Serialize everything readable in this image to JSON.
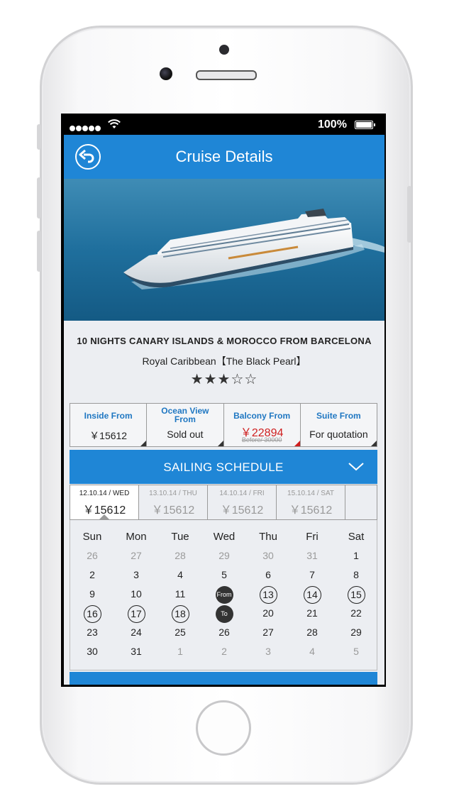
{
  "status_bar": {
    "battery": "100%"
  },
  "header": {
    "title": "Cruise Details"
  },
  "cruise": {
    "title": "10 NIGHTS CANARY ISLANDS & MOROCCO FROM BARCELONA",
    "line": "Royal Caribbean【The Black Pearl】",
    "stars": "★★★☆☆",
    "rating": 3
  },
  "cabins": [
    {
      "label": "Inside From",
      "value": "￥15612"
    },
    {
      "label": "Ocean View From",
      "value": "Sold out"
    },
    {
      "label": "Balcony From",
      "value": "￥22894",
      "before": "Before/ 30000"
    },
    {
      "label": "Suite From",
      "value": "For quotation"
    }
  ],
  "schedule": {
    "title": "SAILING SCHEDULE",
    "dates": [
      {
        "date": "12.10.14 / WED",
        "price": "￥15612"
      },
      {
        "date": "13.10.14 / THU",
        "price": "￥15612"
      },
      {
        "date": "14.10.14 / FRI",
        "price": "￥15612"
      },
      {
        "date": "15.10.14 / SAT",
        "price": "￥15612"
      }
    ]
  },
  "calendar": {
    "weekdays": [
      "Sun",
      "Mon",
      "Tue",
      "Wed",
      "Thu",
      "Fri",
      "Sat"
    ],
    "from_label": "From",
    "to_label": "To",
    "days": [
      "26",
      "27",
      "28",
      "29",
      "30",
      "31",
      "1",
      "2",
      "3",
      "4",
      "5",
      "6",
      "7",
      "8",
      "9",
      "10",
      "11",
      "From",
      "13",
      "14",
      "15",
      "16",
      "17",
      "18",
      "To",
      "20",
      "21",
      "22",
      "23",
      "24",
      "25",
      "26",
      "27",
      "28",
      "29",
      "30",
      "31",
      "1",
      "2",
      "3",
      "4",
      "5"
    ],
    "muted": [
      0,
      1,
      2,
      3,
      4,
      5,
      37,
      38,
      39,
      40,
      41
    ],
    "circled": [
      18,
      19,
      20,
      21,
      22,
      23
    ],
    "filled": [
      17,
      24
    ]
  },
  "colors": {
    "primary": "#1f86d6",
    "price_red": "#cf1f1f",
    "label_blue": "#1f77c2"
  }
}
